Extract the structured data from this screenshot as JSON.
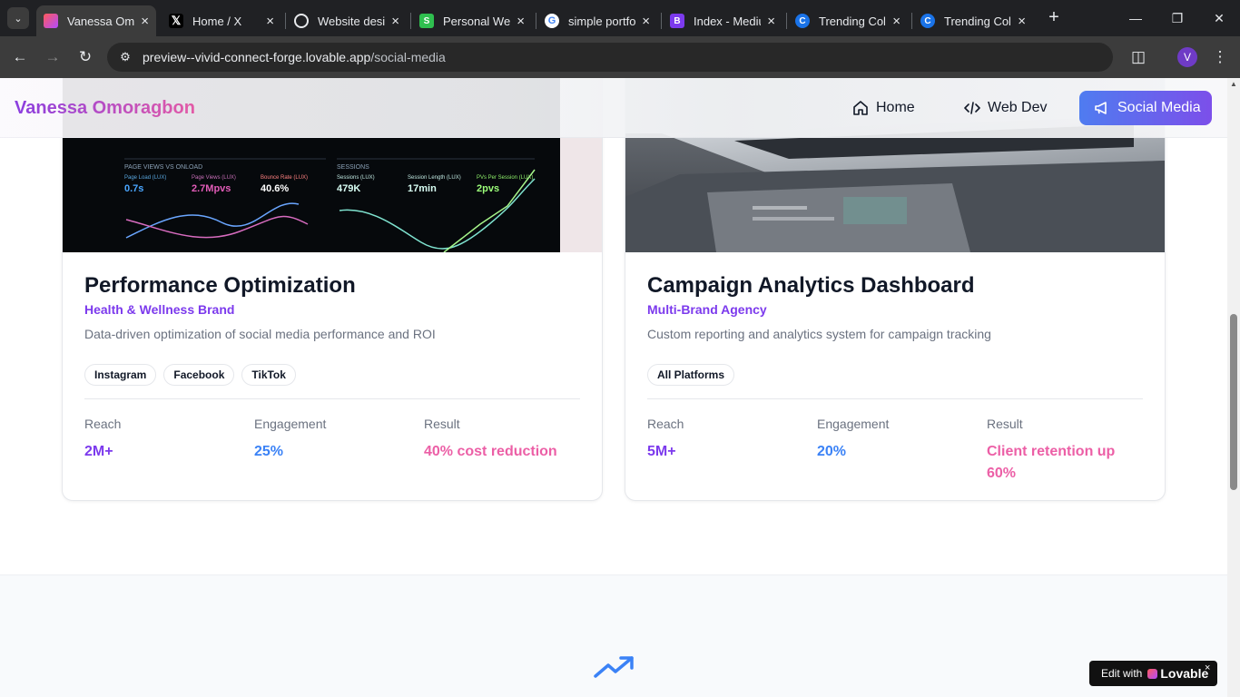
{
  "browser": {
    "tabs": [
      {
        "title": "Vanessa Omoragbon",
        "favicon_color": "#e35aa6",
        "favicon": "lovable-heart-icon"
      },
      {
        "title": "Home / X",
        "favicon_color": "#000000",
        "favicon": "x-icon"
      },
      {
        "title": "Website design",
        "favicon_color": "#202124",
        "favicon": "chatgpt-icon"
      },
      {
        "title": "Personal Website",
        "favicon_color": "#2fbf4f",
        "favicon": "s-icon"
      },
      {
        "title": "simple portfolio",
        "favicon_color": "#ffffff",
        "favicon": "google-icon"
      },
      {
        "title": "Index - Medium",
        "favicon_color": "#7c3aed",
        "favicon": "b-icon"
      },
      {
        "title": "Trending Colors",
        "favicon_color": "#1a73e8",
        "favicon": "coolors-icon"
      },
      {
        "title": "Trending Colors",
        "favicon_color": "#1a73e8",
        "favicon": "coolors-icon"
      }
    ],
    "url_host": "preview--vivid-connect-forge.lovable.app",
    "url_path": "/social-media",
    "profile_initial": "V"
  },
  "site": {
    "brand": "Vanessa Omoragbon",
    "nav": {
      "home": "Home",
      "webdev": "Web Dev",
      "social": "Social Media"
    }
  },
  "projects": [
    {
      "title": "Performance Optimization",
      "client": "Health & Wellness Brand",
      "description": "Data-driven optimization of social media performance and ROI",
      "tags": [
        "Instagram",
        "Facebook",
        "TikTok"
      ],
      "metrics": {
        "reach_label": "Reach",
        "reach": "2M+",
        "engagement_label": "Engagement",
        "engagement": "25%",
        "result_label": "Result",
        "result": "40% cost reduction"
      },
      "image_readouts": {
        "page_load_label": "Page Load (LUX)",
        "page_load": "0.7s",
        "page_views_label": "Page Views (LUX)",
        "page_views": "2.7Mpvs",
        "bounce_label": "Bounce Rate (LUX)",
        "bounce": "40.6%",
        "sessions_label": "Sessions (LUX)",
        "sessions": "479K",
        "session_len_label": "Session Length (LUX)",
        "session_len": "17min",
        "pvs_label": "PVs Per Session (LUX)",
        "pvs": "2pvs"
      }
    },
    {
      "title": "Campaign Analytics Dashboard",
      "client": "Multi-Brand Agency",
      "description": "Custom reporting and analytics system for campaign tracking",
      "tags": [
        "All Platforms"
      ],
      "metrics": {
        "reach_label": "Reach",
        "reach": "5M+",
        "engagement_label": "Engagement",
        "engagement": "20%",
        "result_label": "Result",
        "result": "Client retention up 60%"
      }
    }
  ],
  "lovable_badge": {
    "prefix": "Edit with",
    "brand": "Lovable",
    "close": "×"
  },
  "colors": {
    "accent_purple": "#7c3aed",
    "accent_blue": "#3b82f6",
    "accent_pink": "#ec5fa6"
  }
}
